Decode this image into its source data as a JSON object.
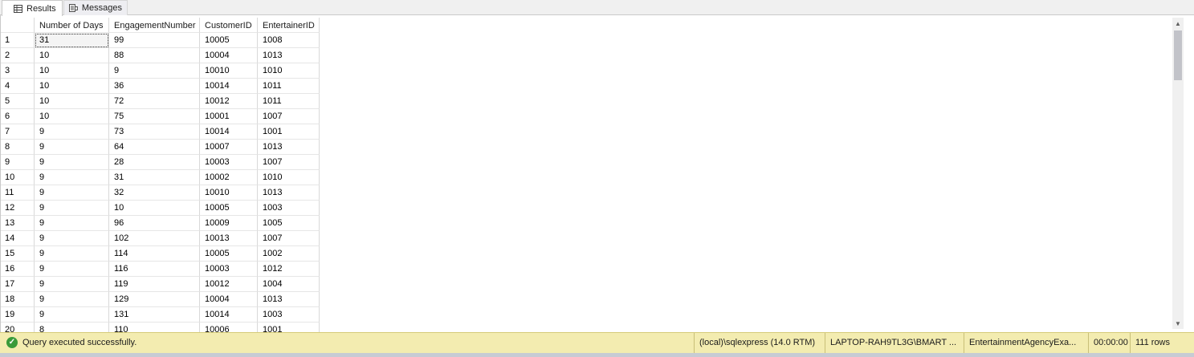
{
  "tabs": [
    {
      "label": "Results",
      "icon": "grid-icon"
    },
    {
      "label": "Messages",
      "icon": "messages-icon"
    }
  ],
  "grid": {
    "columns": [
      "",
      "Number of Days",
      "EngagementNumber",
      "CustomerID",
      "EntertainerID"
    ],
    "rows": [
      [
        "1",
        "31",
        "99",
        "10005",
        "1008"
      ],
      [
        "2",
        "10",
        "88",
        "10004",
        "1013"
      ],
      [
        "3",
        "10",
        "9",
        "10010",
        "1010"
      ],
      [
        "4",
        "10",
        "36",
        "10014",
        "1011"
      ],
      [
        "5",
        "10",
        "72",
        "10012",
        "1011"
      ],
      [
        "6",
        "10",
        "75",
        "10001",
        "1007"
      ],
      [
        "7",
        "9",
        "73",
        "10014",
        "1001"
      ],
      [
        "8",
        "9",
        "64",
        "10007",
        "1013"
      ],
      [
        "9",
        "9",
        "28",
        "10003",
        "1007"
      ],
      [
        "10",
        "9",
        "31",
        "10002",
        "1010"
      ],
      [
        "11",
        "9",
        "32",
        "10010",
        "1013"
      ],
      [
        "12",
        "9",
        "10",
        "10005",
        "1003"
      ],
      [
        "13",
        "9",
        "96",
        "10009",
        "1005"
      ],
      [
        "14",
        "9",
        "102",
        "10013",
        "1007"
      ],
      [
        "15",
        "9",
        "114",
        "10005",
        "1002"
      ],
      [
        "16",
        "9",
        "116",
        "10003",
        "1012"
      ],
      [
        "17",
        "9",
        "119",
        "10012",
        "1004"
      ],
      [
        "18",
        "9",
        "129",
        "10004",
        "1013"
      ],
      [
        "19",
        "9",
        "131",
        "10014",
        "1003"
      ],
      [
        "20",
        "8",
        "110",
        "10006",
        "1001"
      ]
    ]
  },
  "status": {
    "message": "Query executed successfully.",
    "server": "(local)\\sqlexpress (14.0 RTM)",
    "user": "LAPTOP-RAH9TL3G\\BMART ...",
    "database": "EntertainmentAgencyExa...",
    "elapsed": "00:00:00",
    "rows": "111 rows"
  },
  "colors": {
    "status_bg": "#f3ecb0",
    "ok_green": "#3a9b3a",
    "frame": "#c7cbd4"
  }
}
